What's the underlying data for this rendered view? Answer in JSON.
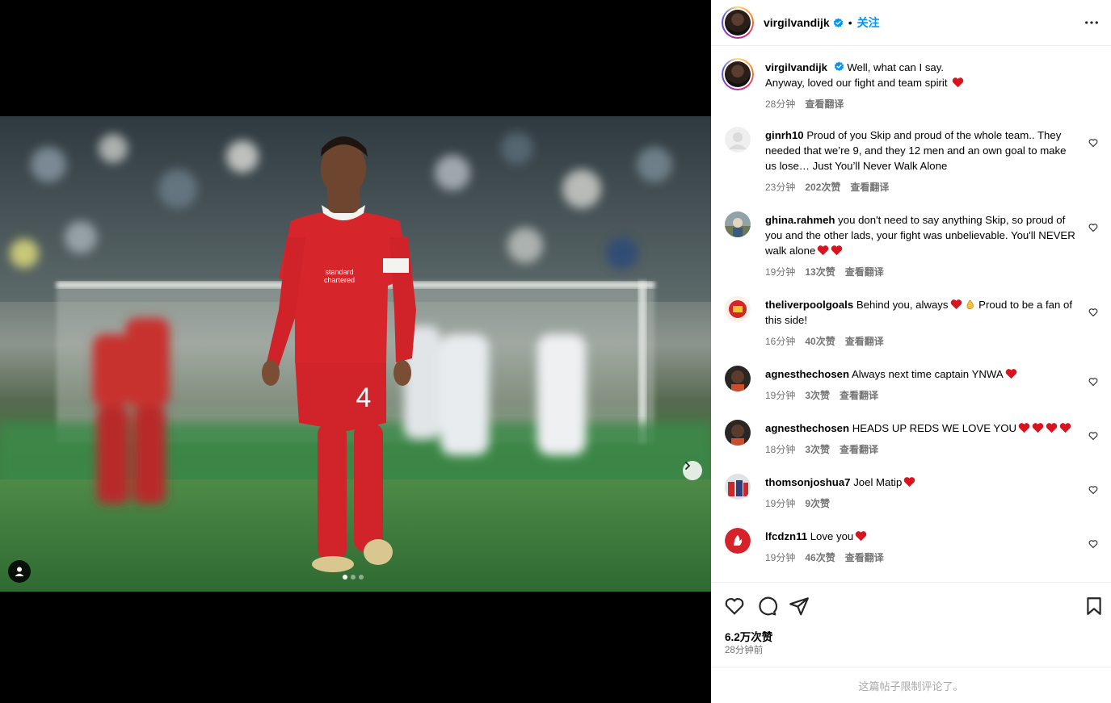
{
  "media": {
    "carousel_total": 3,
    "carousel_active": 1
  },
  "header": {
    "username": "virgilvandijk",
    "separator": "•",
    "follow_label": "关注"
  },
  "caption": {
    "username": "virgilvandijk",
    "line1": "Well, what can I say.",
    "line2": "Anyway, loved our fight and team spirit",
    "time": "28分钟",
    "translate": "查看翻译"
  },
  "comments": [
    {
      "username": "ginrh10",
      "text": "Proud of you Skip and proud of the whole team.. They needed that we’re 9, and they 12 men and an own goal to make us lose… Just You’ll Never Walk Alone",
      "hearts": 0,
      "time": "23分钟",
      "likes": "202次赞",
      "translate": "查看翻译",
      "avatar": "default"
    },
    {
      "username": "ghina.rahmeh",
      "text": "you don't need to say anything Skip, so proud of you and the other lads, your fight was unbelievable. You'll NEVER walk alone",
      "hearts": 2,
      "time": "19分钟",
      "likes": "13次赞",
      "translate": "查看翻译",
      "avatar": "photo-outdoor"
    },
    {
      "username": "theliverpoolgoals",
      "text": "Behind you, always",
      "text_after": "Proud to be a fan of this side!",
      "hearts": 1,
      "clap": true,
      "time": "16分钟",
      "likes": "40次赞",
      "translate": "查看翻译",
      "avatar": "badge"
    },
    {
      "username": "agnesthechosen",
      "text": "Always next time captain YNWA",
      "hearts": 1,
      "time": "19分钟",
      "likes": "3次赞",
      "translate": "查看翻译",
      "avatar": "portrait"
    },
    {
      "username": "agnesthechosen",
      "text": "HEADS UP REDS WE LOVE YOU",
      "hearts": 4,
      "time": "18分钟",
      "likes": "3次赞",
      "translate": "查看翻译",
      "avatar": "portrait"
    },
    {
      "username": "thomsonjoshua7",
      "text": "Joel Matip",
      "hearts": 1,
      "time": "19分钟",
      "likes": "9次赞",
      "translate": "",
      "avatar": "photo-people"
    },
    {
      "username": "lfcdzn11",
      "text": "Love you",
      "hearts": 1,
      "time": "19分钟",
      "likes": "46次赞",
      "translate": "查看翻译",
      "avatar": "lfc"
    }
  ],
  "actions": {
    "likes_count": "6.2万次赞",
    "posted_time": "28分钟前",
    "comments_limited": "这篇帖子限制评论了。"
  },
  "colors": {
    "accent": "#0095f6",
    "heart": "#ed2b45",
    "muted": "#737373",
    "lfc_red": "#d4232b"
  }
}
